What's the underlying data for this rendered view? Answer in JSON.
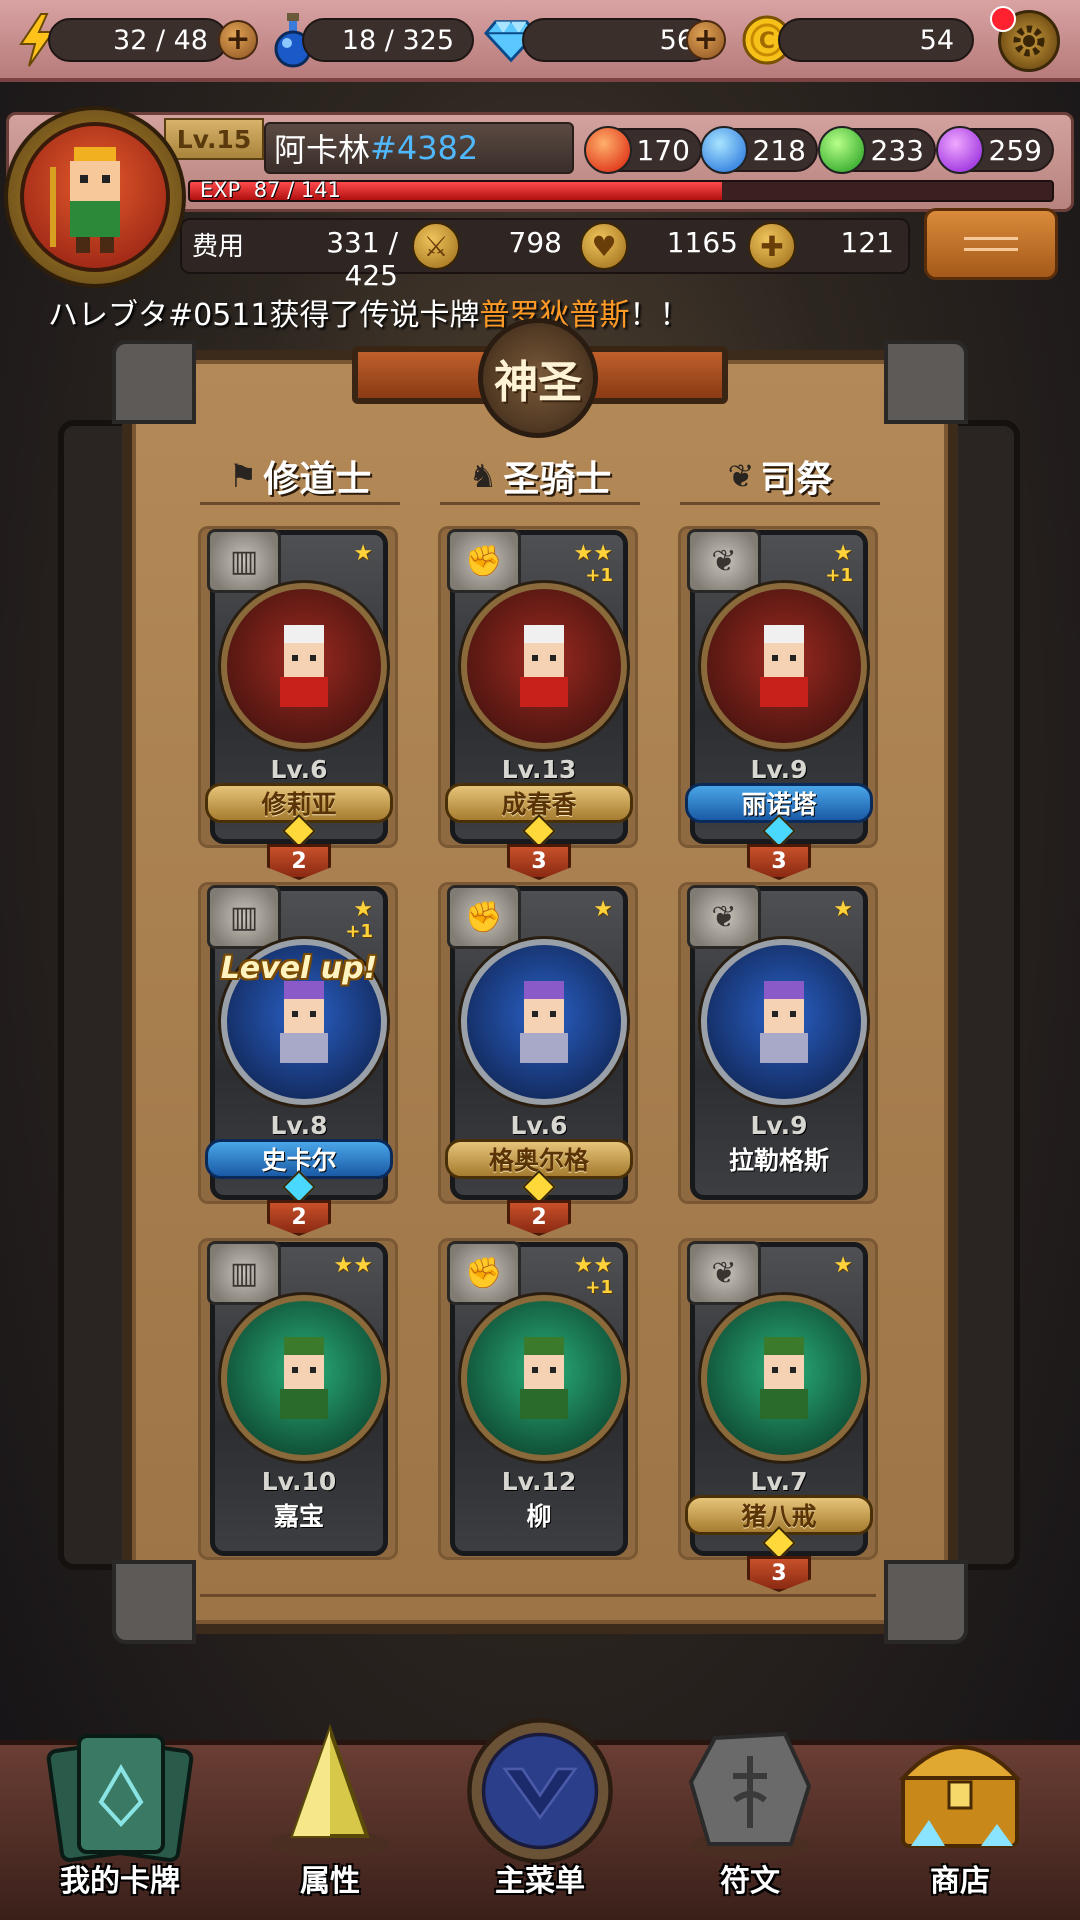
{
  "resources": {
    "energy": "32 / 48",
    "potion": "18 / 325",
    "diamonds": "56",
    "gold": "54"
  },
  "player": {
    "level": "Lv.15",
    "name": "阿卡林",
    "tag": "#4382",
    "exp_label": "EXP",
    "exp_value": "87 / 141",
    "exp_ratio": 0.617
  },
  "gems": {
    "red": "170",
    "blue": "218",
    "green": "233",
    "purple": "259"
  },
  "stats": {
    "cost_label": "费用",
    "cost": "331 / 425",
    "attack": "798",
    "health": "1165",
    "heal": "121"
  },
  "announcement": {
    "prefix": "ハレブタ#0511获得了传说卡牌",
    "highlight": "普罗狄普斯",
    "suffix": "！！"
  },
  "board": {
    "title": "神圣",
    "classes": [
      "修道士",
      "圣骑士",
      "司祭"
    ]
  },
  "cards": [
    {
      "stars": "★",
      "plus": "",
      "level": "Lv.6",
      "name": "修莉亚",
      "banner": "gold",
      "count": "2",
      "portrait": "red",
      "class_icon": "book",
      "levelup": ""
    },
    {
      "stars": "★★",
      "plus": "+1",
      "level": "Lv.13",
      "name": "成春香",
      "banner": "gold",
      "count": "3",
      "portrait": "red",
      "class_icon": "fist",
      "levelup": ""
    },
    {
      "stars": "★",
      "plus": "+1",
      "level": "Lv.9",
      "name": "丽诺塔",
      "banner": "blue",
      "count": "3",
      "portrait": "red",
      "class_icon": "wings",
      "levelup": ""
    },
    {
      "stars": "★",
      "plus": "+1",
      "level": "Lv.8",
      "name": "史卡尔",
      "banner": "blue",
      "count": "2",
      "portrait": "blue",
      "class_icon": "book",
      "levelup": "Level up!"
    },
    {
      "stars": "★",
      "plus": "",
      "level": "Lv.6",
      "name": "格奥尔格",
      "banner": "gold",
      "count": "2",
      "portrait": "blue",
      "class_icon": "fist",
      "levelup": ""
    },
    {
      "stars": "★",
      "plus": "",
      "level": "Lv.9",
      "name": "拉勒格斯",
      "banner": "none",
      "count": "",
      "portrait": "blue",
      "class_icon": "wings",
      "levelup": ""
    },
    {
      "stars": "★★",
      "plus": "",
      "level": "Lv.10",
      "name": "嘉宝",
      "banner": "none",
      "count": "",
      "portrait": "green",
      "class_icon": "book",
      "levelup": ""
    },
    {
      "stars": "★★",
      "plus": "+1",
      "level": "Lv.12",
      "name": "柳",
      "banner": "none",
      "count": "",
      "portrait": "green",
      "class_icon": "fist",
      "levelup": ""
    },
    {
      "stars": "★",
      "plus": "",
      "level": "Lv.7",
      "name": "猪八戒",
      "banner": "gold",
      "count": "3",
      "portrait": "green",
      "class_icon": "wings",
      "levelup": ""
    }
  ],
  "nav": [
    "我的卡牌",
    "属性",
    "主菜单",
    "符文",
    "商店"
  ],
  "colors": {
    "accent_orange": "#ff9a26",
    "tag_blue": "#4fb8ff",
    "exp_red": "#e02020",
    "board_wood": "#a67c4c"
  }
}
